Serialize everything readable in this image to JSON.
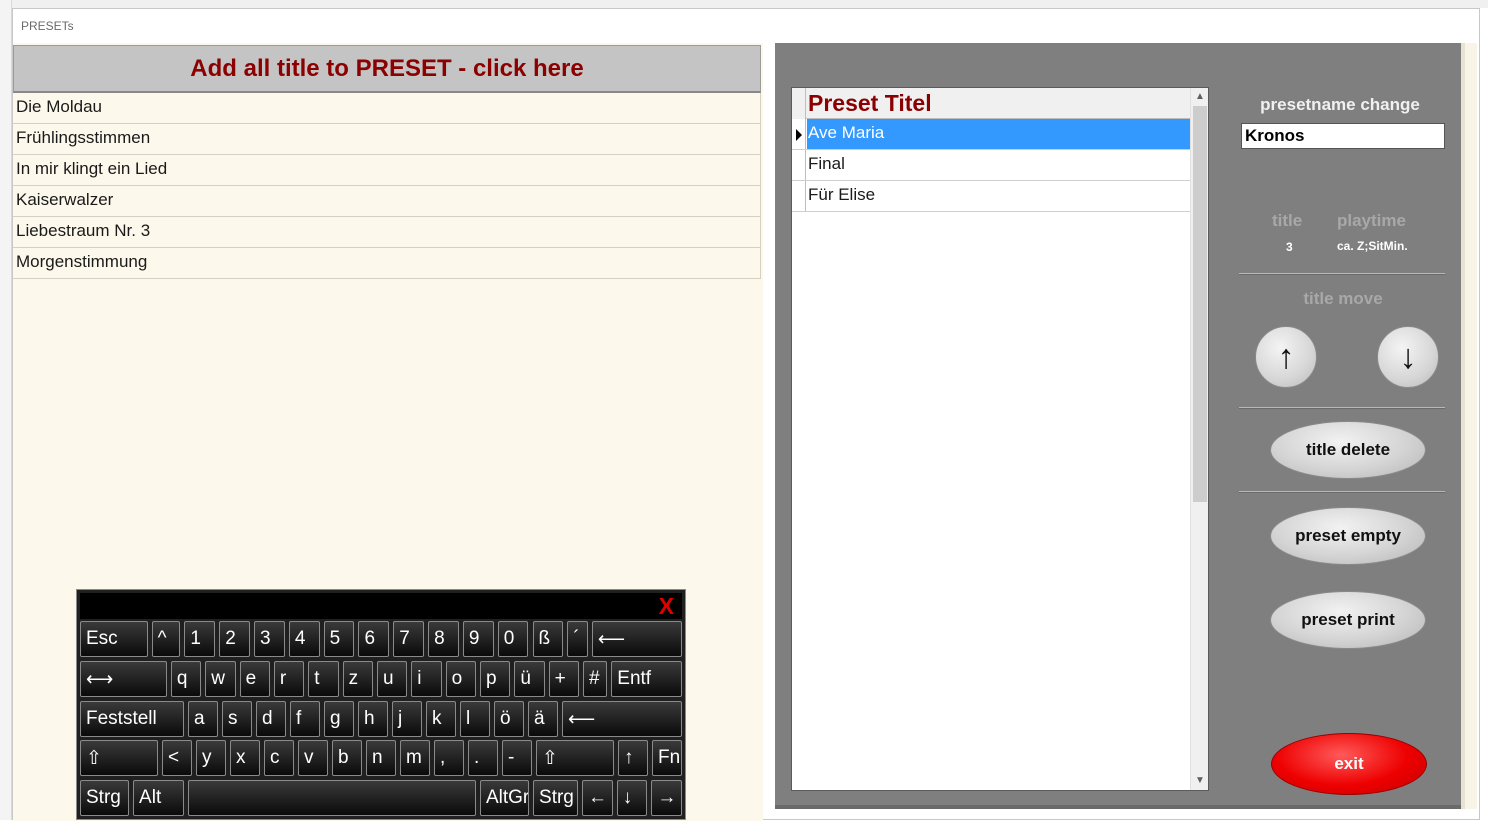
{
  "window": {
    "title": "PRESETs"
  },
  "left": {
    "add_all_label": "Add all title to PRESET - click here",
    "titles": [
      "Die Moldau",
      "Frühlingsstimmen",
      "In mir klingt ein Lied",
      "Kaiserwalzer",
      "Liebestraum Nr. 3",
      "Morgenstimmung"
    ]
  },
  "preset_grid": {
    "header": "Preset Titel",
    "rows": [
      "Ave Maria",
      "Final",
      "Für Elise"
    ],
    "selected_index": 0
  },
  "controls": {
    "presetname_label": "presetname change",
    "presetname_value": "Kronos",
    "title_label": "title",
    "playtime_label": "playtime",
    "title_count": "3",
    "playtime_value": "ca. Z;SitMin.",
    "title_move_label": "title move",
    "move_up": "↑",
    "move_down": "↓",
    "title_delete": "title delete",
    "preset_empty": "preset empty",
    "preset_print": "preset print",
    "exit": "exit"
  },
  "keyboard": {
    "close": "X",
    "rows": [
      [
        "Esc",
        "^",
        "1",
        "2",
        "3",
        "4",
        "5",
        "6",
        "7",
        "8",
        "9",
        "0",
        "ß",
        "´",
        "⟵"
      ],
      [
        "⟷",
        "q",
        "w",
        "e",
        "r",
        "t",
        "z",
        "u",
        "i",
        "o",
        "p",
        "ü",
        "+",
        "#",
        "Entf"
      ],
      [
        "Feststell",
        "a",
        "s",
        "d",
        "f",
        "g",
        "h",
        "j",
        "k",
        "l",
        "ö",
        "ä",
        "⟵"
      ],
      [
        "⇧",
        "<",
        "y",
        "x",
        "c",
        "v",
        "b",
        "n",
        "m",
        ",",
        ".",
        "-",
        "⇧",
        "↑",
        "Fn"
      ],
      [
        "Strg",
        "Alt",
        "",
        "AltGr",
        "Strg",
        "←",
        "↓",
        "→"
      ]
    ]
  },
  "colors": {
    "accent_red": "#8b0000",
    "selection_blue": "#3399ff",
    "exit_red": "#ee0000",
    "panel_grey": "#7f7f7f"
  }
}
